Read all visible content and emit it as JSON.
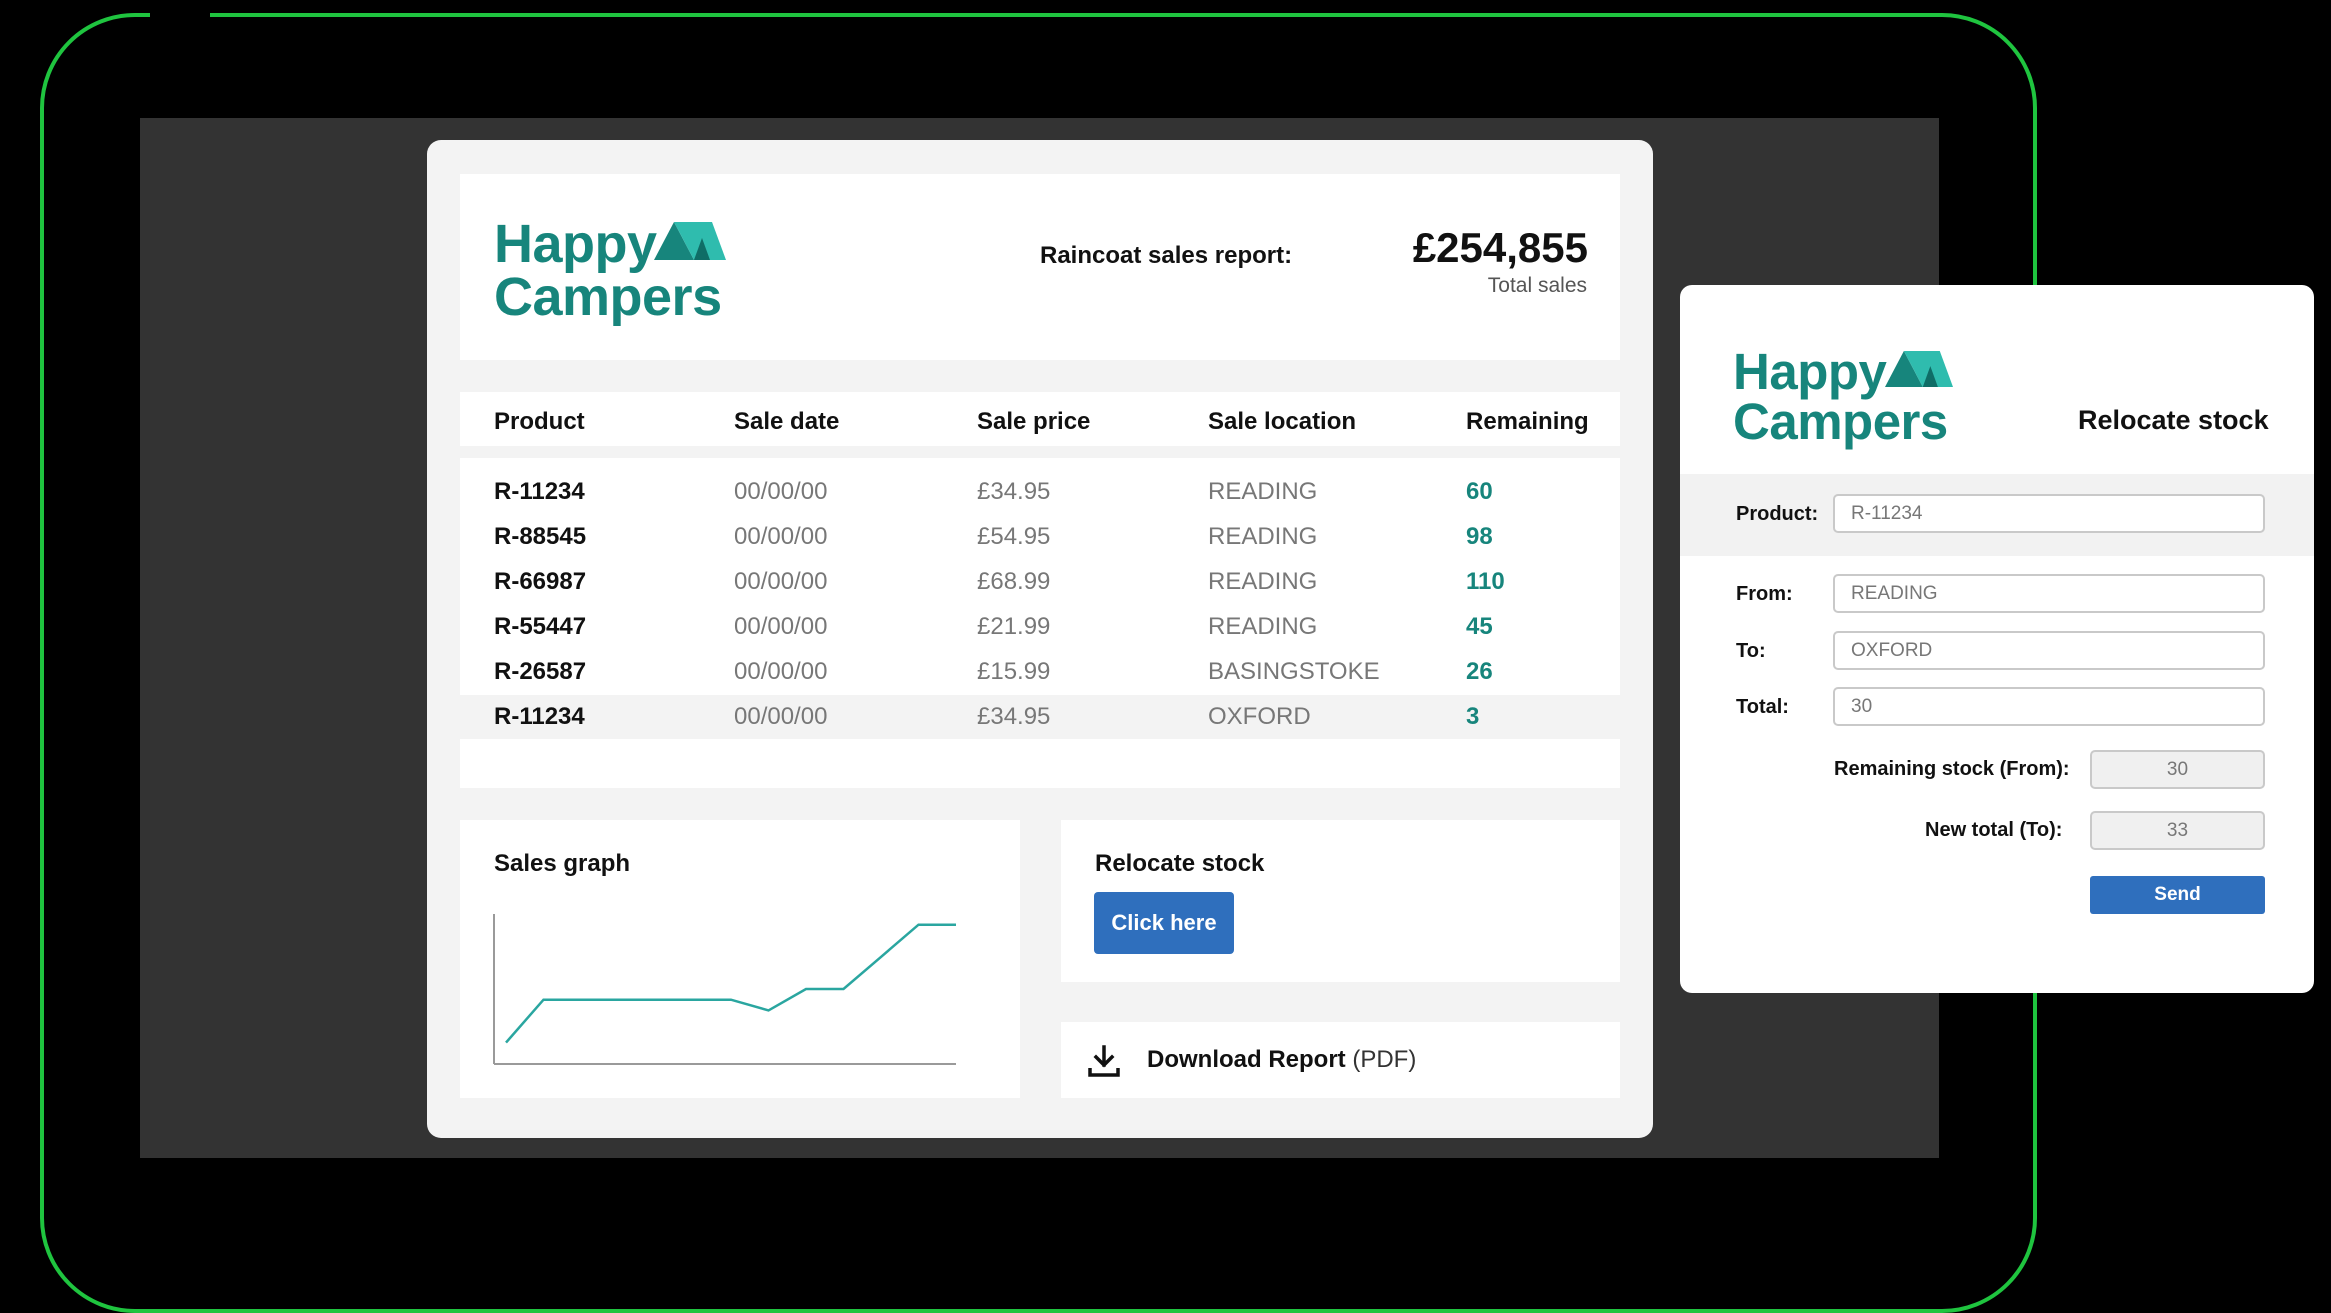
{
  "brand": {
    "name_line1": "Happy",
    "name_line2": "Campers",
    "color": "#17857c"
  },
  "report": {
    "title": "Raincoat sales report:",
    "total_value": "£254,855",
    "total_label": "Total sales"
  },
  "table": {
    "columns": [
      "Product",
      "Sale date",
      "Sale price",
      "Sale location",
      "Remaining"
    ],
    "rows": [
      {
        "product": "R-11234",
        "date": "00/00/00",
        "price": "£34.95",
        "location": "READING",
        "remaining": "60"
      },
      {
        "product": "R-88545",
        "date": "00/00/00",
        "price": "£54.95",
        "location": "READING",
        "remaining": "98"
      },
      {
        "product": "R-66987",
        "date": "00/00/00",
        "price": "£68.99",
        "location": "READING",
        "remaining": "110"
      },
      {
        "product": "R-55447",
        "date": "00/00/00",
        "price": "£21.99",
        "location": "READING",
        "remaining": "45"
      },
      {
        "product": "R-26587",
        "date": "00/00/00",
        "price": "£15.99",
        "location": "BASINGSTOKE",
        "remaining": "26"
      },
      {
        "product": "R-11234",
        "date": "00/00/00",
        "price": "£34.95",
        "location": "OXFORD",
        "remaining": "3"
      }
    ]
  },
  "sales_graph": {
    "title": "Sales graph"
  },
  "chart_data": {
    "type": "line",
    "title": "Sales graph",
    "xlabel": "",
    "ylabel": "",
    "x": [
      0,
      1,
      2,
      3,
      4,
      5,
      6,
      7,
      8,
      9,
      10,
      11,
      12
    ],
    "series": [
      {
        "values": [
          1,
          3,
          3,
          3,
          3,
          3,
          3,
          2.5,
          3.5,
          3.5,
          5,
          6.5,
          6.5
        ]
      }
    ],
    "line_color": "#2aa6a0"
  },
  "relocate_card": {
    "title": "Relocate stock",
    "button_label": "Click here"
  },
  "download": {
    "label": "Download Report",
    "suffix": "(PDF)",
    "icon": "download-icon"
  },
  "relocate_panel": {
    "title": "Relocate stock",
    "product_label": "Product:",
    "product_value": "R-11234",
    "from_label": "From:",
    "from_value": "READING",
    "to_label": "To:",
    "to_value": "OXFORD",
    "total_label": "Total:",
    "total_value": "30",
    "remaining_label": "Remaining stock (From):",
    "remaining_value": "30",
    "newtotal_label": "New total (To):",
    "newtotal_value": "33",
    "send_label": "Send"
  },
  "colors": {
    "frame": "#1fc43f",
    "button": "#2f6fbd",
    "teal": "#17857c"
  }
}
